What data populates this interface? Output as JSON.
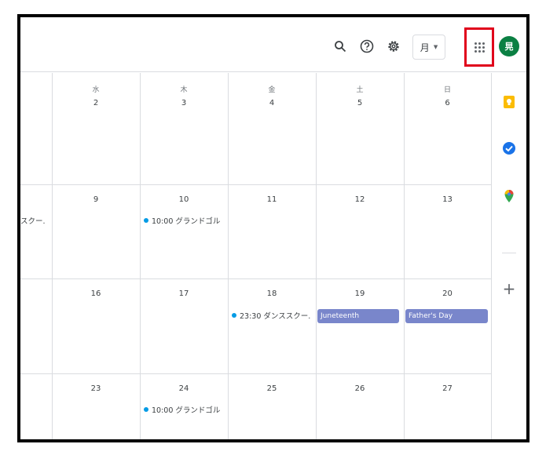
{
  "header": {
    "view_label": "月",
    "avatar_initial": "晃"
  },
  "weekdays": [
    "水",
    "木",
    "金",
    "土",
    "日"
  ],
  "weeks": [
    {
      "dates": [
        "2",
        "3",
        "4",
        "5",
        "6"
      ]
    },
    {
      "dates": [
        "9",
        "10",
        "11",
        "12",
        "13"
      ]
    },
    {
      "dates": [
        "16",
        "17",
        "18",
        "19",
        "20"
      ]
    },
    {
      "dates": [
        "23",
        "24",
        "25",
        "26",
        "27"
      ]
    }
  ],
  "events": {
    "w2_prev": "スクー.",
    "w2_thu": "10:00 グランドゴル",
    "w3_fri": "23:30 ダンススクー.",
    "w3_sat": "Juneteenth",
    "w3_sun": "Father's Day",
    "w4_thu": "10:00 グランドゴル"
  },
  "colors": {
    "accent": "#1a73e8",
    "event_dot": "#039be5",
    "holiday_chip": "#7986cb",
    "avatar": "#0b8043",
    "highlight_box": "#e0001b"
  },
  "side_panel": {
    "icons": [
      "keep-icon",
      "tasks-icon",
      "maps-icon",
      "add-icon"
    ]
  }
}
